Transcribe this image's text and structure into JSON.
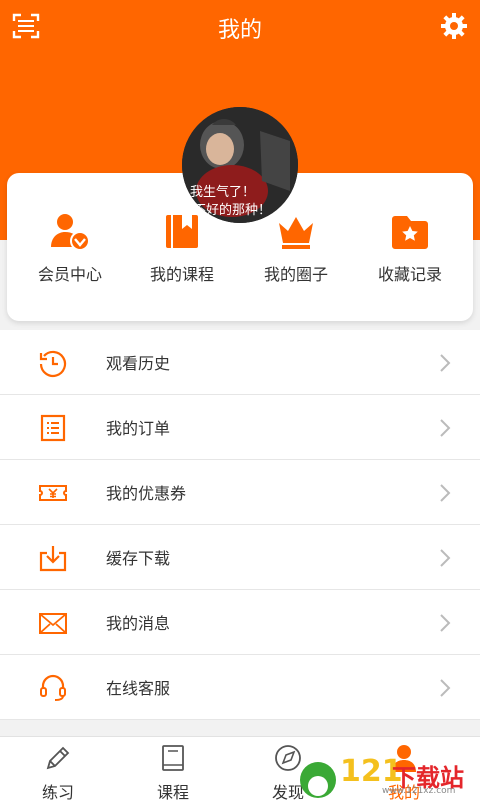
{
  "header": {
    "title": "我的",
    "scan_icon": "scan-icon",
    "settings_icon": "gear-icon"
  },
  "profile": {
    "avatar_text_line1": "我生气了！",
    "avatar_text_line2": "是不好的那种！"
  },
  "shortcuts": [
    {
      "label": "会员中心",
      "icon": "member-icon"
    },
    {
      "label": "我的课程",
      "icon": "book-icon"
    },
    {
      "label": "我的圈子",
      "icon": "crown-icon"
    },
    {
      "label": "收藏记录",
      "icon": "favorite-folder-icon"
    }
  ],
  "menu": [
    {
      "label": "观看历史",
      "icon": "history-icon"
    },
    {
      "label": "我的订单",
      "icon": "order-icon"
    },
    {
      "label": "我的优惠券",
      "icon": "coupon-icon"
    },
    {
      "label": "缓存下载",
      "icon": "download-icon"
    },
    {
      "label": "我的消息",
      "icon": "mail-icon"
    },
    {
      "label": "在线客服",
      "icon": "headset-icon"
    }
  ],
  "tabs": [
    {
      "label": "练习",
      "icon": "pencil-icon"
    },
    {
      "label": "课程",
      "icon": "course-book-icon"
    },
    {
      "label": "发现",
      "icon": "discover-icon"
    },
    {
      "label": "我的",
      "icon": "profile-icon",
      "active": true
    }
  ],
  "watermark": {
    "number": "121",
    "text": "下载站",
    "url": "www.121xz.com"
  },
  "colors": {
    "accent": "#ff6600",
    "text": "#333333",
    "divider": "#e6e6e6",
    "chevron": "#bbbbbb"
  }
}
